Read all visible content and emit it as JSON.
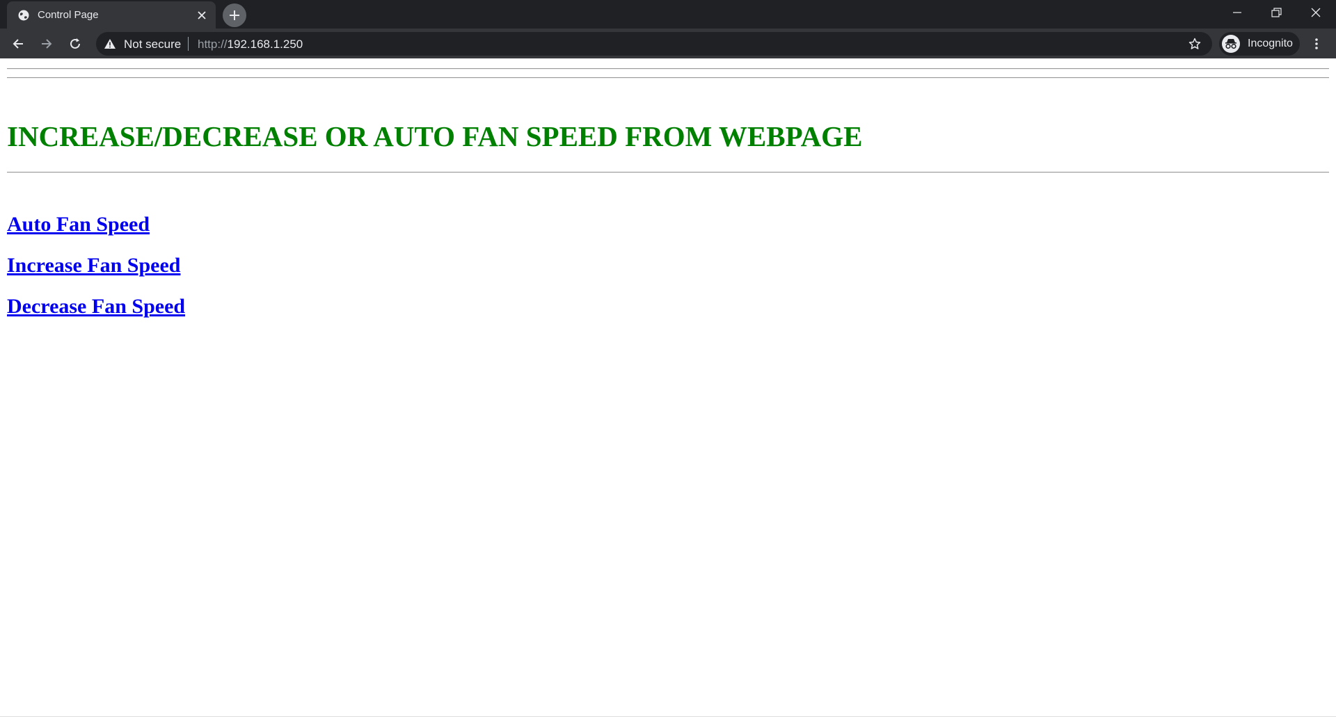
{
  "browser": {
    "tab_title": "Control Page",
    "omnibox": {
      "security_label": "Not secure",
      "url_scheme": "http://",
      "url_host": "192.168.1.250"
    },
    "profile_label": "Incognito",
    "icons": {
      "tab_favicon": "globe-icon",
      "tab_close": "close-icon",
      "new_tab": "plus-icon",
      "back": "arrow-left-icon",
      "forward": "arrow-right-icon",
      "reload": "reload-icon",
      "security": "warning-icon",
      "bookmark": "star-icon",
      "profile": "incognito-icon",
      "menu": "kebab-menu-icon",
      "minimize": "minimize-icon",
      "maximize": "restore-icon",
      "close_window": "close-icon"
    },
    "colors": {
      "tabbar": "#202124",
      "toolbar": "#35363a",
      "text": "#e8eaed"
    }
  },
  "page": {
    "heading": "INCREASE/DECREASE OR AUTO FAN SPEED FROM WEBPAGE",
    "heading_color": "#008000",
    "link_color": "#0000ee",
    "links": [
      {
        "label": "Auto Fan Speed"
      },
      {
        "label": "Increase Fan Speed"
      },
      {
        "label": "Decrease Fan Speed"
      }
    ]
  }
}
